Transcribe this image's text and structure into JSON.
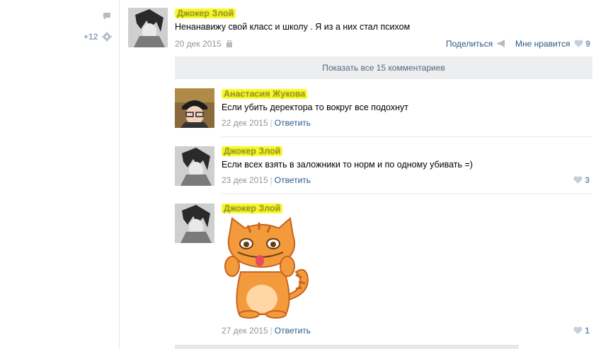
{
  "sidebar": {
    "share_count": "+12"
  },
  "post": {
    "text": "Ненанавижу свой класс и школу . Я из а них стал психом",
    "date": "20 дек 2015",
    "share_label": "Поделиться",
    "like_label": "Мне нравится",
    "like_count": "9"
  },
  "comments_bar": {
    "label": "Показать все 15 комментариев"
  },
  "comments": [
    {
      "text": "Если убить деректора то вокруг все подохнут",
      "date": "22 дек 2015",
      "reply": "Ответить",
      "likes": ""
    },
    {
      "text": "Если всех взять в заложники то норм и по одному убивать =)",
      "date": "23 дек 2015",
      "reply": "Ответить",
      "likes": "3"
    },
    {
      "text": "",
      "date": "27 дек 2015",
      "reply": "Ответить",
      "likes": "1"
    }
  ],
  "colors": {
    "link": "#2a5885",
    "muted": "#939393",
    "highlight": "#f7f82a",
    "bar": "#edeef0"
  },
  "icons": [
    "comment-icon",
    "gear-icon",
    "lock-icon",
    "megaphone-icon",
    "heart-icon",
    "cat-sticker"
  ]
}
